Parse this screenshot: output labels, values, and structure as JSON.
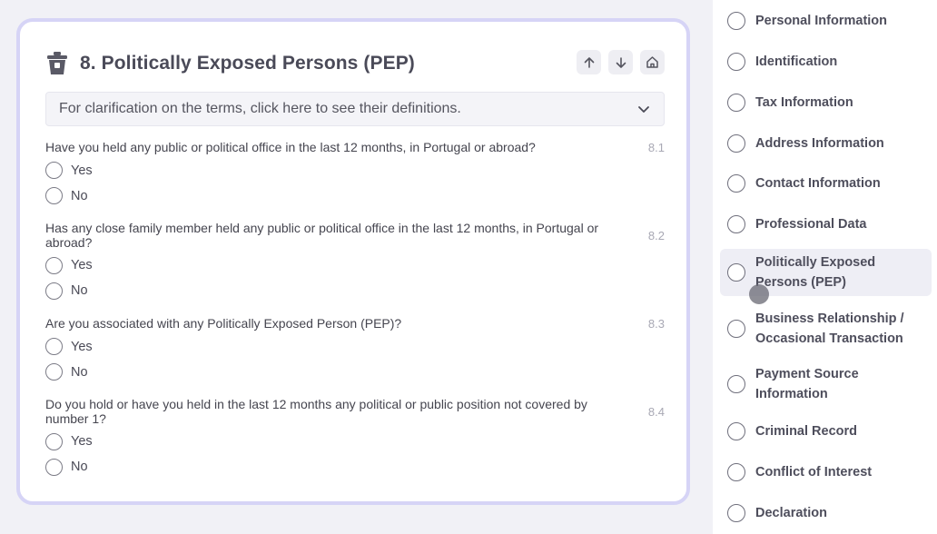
{
  "section": {
    "title": "8. Politically Exposed Persons (PEP)",
    "icon": "trash-icon",
    "clarification": "For clarification on the terms, click here to see their definitions."
  },
  "questions": [
    {
      "text": "Have you held any public or political office in the last 12 months, in Portugal or abroad?",
      "number": "8.1",
      "options": [
        "Yes",
        "No"
      ]
    },
    {
      "text": "Has any close family member held any public or political office in the last 12 months, in Portugal or abroad?",
      "number": "8.2",
      "options": [
        "Yes",
        "No"
      ]
    },
    {
      "text": "Are you associated with any Politically Exposed Person (PEP)?",
      "number": "8.3",
      "options": [
        "Yes",
        "No"
      ]
    },
    {
      "text": "Do you hold or have you held in the last 12 months any political or public position not covered by number 1?",
      "number": "8.4",
      "options": [
        "Yes",
        "No"
      ]
    }
  ],
  "sidebar": {
    "items": [
      {
        "label": "Personal Information",
        "active": false
      },
      {
        "label": "Identification",
        "active": false
      },
      {
        "label": "Tax Information",
        "active": false
      },
      {
        "label": "Address Information",
        "active": false
      },
      {
        "label": "Contact Information",
        "active": false
      },
      {
        "label": "Professional Data",
        "active": false
      },
      {
        "label": "Politically Exposed Persons (PEP)",
        "active": true
      },
      {
        "label": "Business Relationship / Occasional Transaction",
        "active": false
      },
      {
        "label": "Payment Source Information",
        "active": false
      },
      {
        "label": "Criminal Record",
        "active": false
      },
      {
        "label": "Conflict of Interest",
        "active": false
      },
      {
        "label": "Declaration",
        "active": false
      }
    ]
  },
  "colors": {
    "card_border": "#d6d4f6",
    "active_item": "#eeeef5",
    "background": "#f1f1f6"
  }
}
